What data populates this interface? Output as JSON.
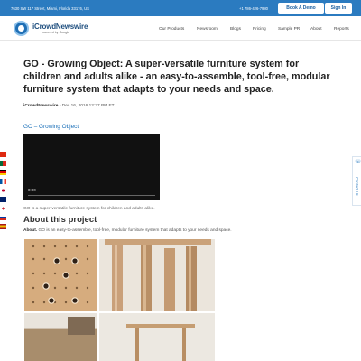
{
  "topbar": {
    "address": "7630 SW 117 Street, Miami, Florida 33176, US",
    "phone": "+1 786-426-7980",
    "book_demo": "Book A Demo",
    "sign_in": "Sign In"
  },
  "brand": {
    "name": "iCrowdNewswire",
    "tagline": "powered by Google"
  },
  "nav": [
    "Our Products",
    "Newsroom",
    "Blogs",
    "Pricing",
    "Sample PR",
    "About",
    "Reports"
  ],
  "article": {
    "headline": "GO - Growing Object: A super-versatile furniture system for children and adults alike - an easy-to-assemble, tool-free, modular furniture system that adapts to your needs and space.",
    "author": "iCrowdNewswire",
    "date": " • Dec 16, 2016 12:37 PM ET",
    "video_title": "GO – Growing Object",
    "video_time": "0:00",
    "caption": "GO is a super-versatile furniture system for children and adults alike.",
    "about_title": "About this project",
    "about_lead": "About.",
    "about_text": " GO is an easy-to-assemble, tool-free, modular furniture system that adapts to your needs and space."
  },
  "side": {
    "phone_icon": "phone-icon",
    "contact": "Contact Us"
  },
  "colors": {
    "primary": "#2b7bc0",
    "link": "#1a6fb8"
  },
  "flags": [
    "China",
    "Portugal",
    "Germany",
    "France",
    "Japan",
    "United Kingdom",
    "Korea",
    "Russia",
    "Spain"
  ]
}
